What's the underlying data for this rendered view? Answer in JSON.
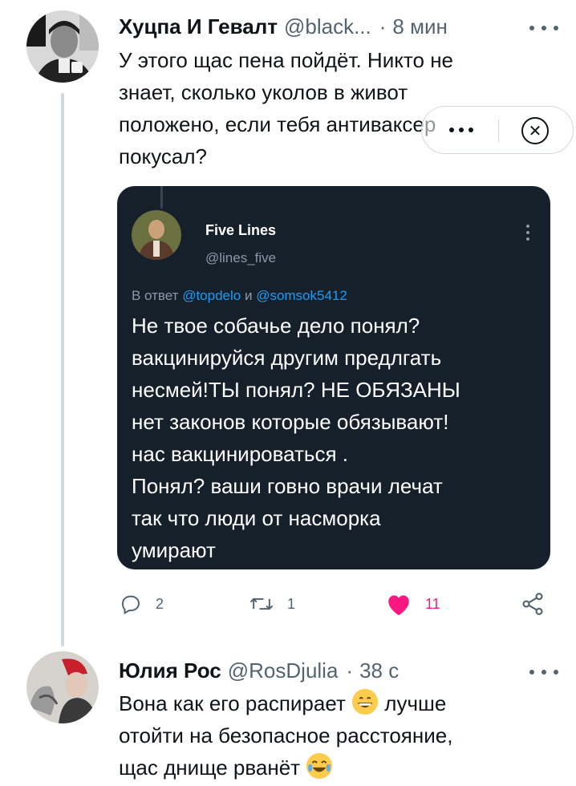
{
  "tweet1": {
    "name": "Хуцпа И Гевалт",
    "handle": "@black...",
    "dot": "·",
    "time": "8 мин",
    "text": "У этого щас пена пойдёт. Никто не\nзнает, сколько уколов в живот\nположено, если тебя антиваксер\nпокусал?",
    "avatar_icon": "man-portrait-avatar",
    "embedded": {
      "name": "Five Lines",
      "handle": "@lines_five",
      "reply_prefix": "В ответ",
      "reply_mention1": "@topdelo",
      "reply_and": "и",
      "reply_mention2": "@somsok5412",
      "text": "Не твое собачье дело понял?\nвакцинируйся другим предлгать\nнесмей!ТЫ понял? НЕ ОБЯЗАНЫ\nнет законов которые обязывают!\nнас вакцинироваться .\nПонял? ваши говно врачи лечат\nтак что люди от насморка\nумирают"
    },
    "actions": {
      "reply_count": "2",
      "retweet_count": "1",
      "like_count": "11"
    },
    "translate_popup": {
      "icons": [
        "more-dots-icon",
        "close-circle-icon"
      ]
    }
  },
  "tweet2": {
    "name": "Юлия Рос",
    "handle": "@RosDjulia",
    "dot": "·",
    "time": "38 с",
    "text_part1": "Вона как его распирает ",
    "text_part2": " лучше\nотойти на безопасное расстояние,\nщас днище рванёт ",
    "emojis": [
      "grinning-face-emoji",
      "tears-of-joy-emoji"
    ]
  },
  "colors": {
    "text": "#0f1419",
    "secondary": "#536471",
    "line": "#cfd9de",
    "embed_bg": "#15202b",
    "link": "#1d9bf0",
    "like": "#f91880"
  }
}
